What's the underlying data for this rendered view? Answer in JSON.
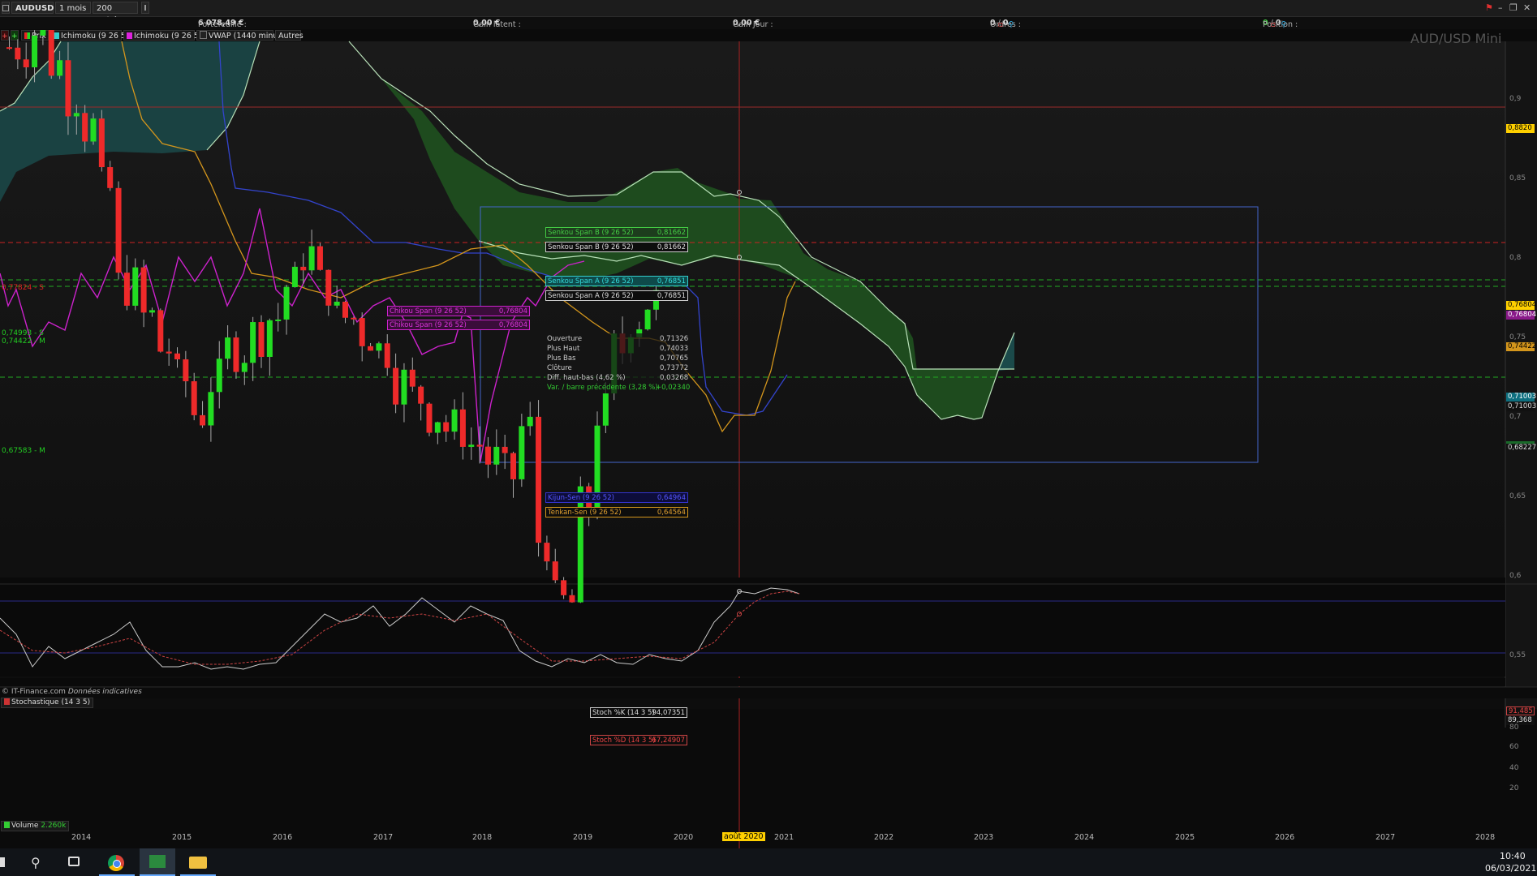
{
  "toolbar": {
    "instrument": "AUDUSD",
    "period": "1 mois",
    "units": "200 unités"
  },
  "infobar": {
    "portfolio_label": "Portefeuille :",
    "portfolio_value": "6 078,49 €",
    "gain_latent_label": "Gain latent :",
    "gain_latent_value": "0,00 €",
    "gain_jour_label": "Gain Jour :",
    "gain_jour_value": "0,00 €",
    "orders_label": "Ordres :",
    "orders_value": "0",
    "orders_value2": "0",
    "position_label": "Position :",
    "position_value": "0",
    "position_value2": "0"
  },
  "indicators": {
    "prix": "Prix",
    "ichimoku1": "Ichimoku (9 26 52)",
    "ichimoku2": "Ichimoku (9 26 52)",
    "vwap": "VWAP (1440 minutes)",
    "autres": "Autres"
  },
  "chart_title": "AUD/USD Mini",
  "copyright": "© IT-Finance.com",
  "copyright_note": "Données indicatives",
  "price_axis": [
    "0,9",
    "0,85",
    "0,8",
    "0,75",
    "0,7",
    "0,65",
    "0,6",
    "0,55"
  ],
  "price_tags": {
    "crosshair": "0,8820",
    "last1": "0,76804",
    "last2": "0,76804",
    "lvl_a": "0,74422",
    "lvl_b": "0,71003",
    "lvl_c": "0,71003",
    "lvl_d": "0,68227"
  },
  "levels": {
    "r1": "0,77824 - S",
    "s1": "0,74993 - S",
    "m1": "0,74422 - M",
    "m2": "0,67583 - M"
  },
  "tooltips": {
    "ssb1_label": "Senkou Span B (9 26 52)",
    "ssb1_value": "0,81662",
    "ssb2_label": "Senkou Span B (9 26 52)",
    "ssb2_value": "0,81662",
    "ssa1_label": "Senkou Span A (9 26 52)",
    "ssa1_value": "0,76851",
    "ssa2_label": "Senkou Span A (9 26 52)",
    "ssa2_value": "0,76851",
    "chikou1_label": "Chikou Span (9 26 52)",
    "chikou1_value": "0,76804",
    "chikou2_label": "Chikou Span (9 26 52)",
    "chikou2_value": "0,76804",
    "kijun_label": "Kijun-Sen (9 26 52)",
    "kijun_value": "0,64964",
    "tenkan_label": "Tenkan-Sen (9 26 52)",
    "tenkan_value": "0,64564"
  },
  "ohlc": [
    {
      "label": "Ouverture",
      "value": "0,71326"
    },
    {
      "label": "Plus Haut",
      "value": "0,74033"
    },
    {
      "label": "Plus Bas",
      "value": "0,70765"
    },
    {
      "label": "Clôture",
      "value": "0,73772"
    },
    {
      "label": "Diff. haut-bas (4,62 %)",
      "value": "0,03268"
    },
    {
      "label": "Var. / barre précédente (3,28 %)",
      "value": "+0,02340"
    }
  ],
  "stoch": {
    "title": "Stochastique (14 3 5)",
    "k_label": "Stoch %K (14 3 5)",
    "k_value": "94,07351",
    "d_label": "Stoch %D (14 3 5)",
    "d_value": "67,24907",
    "tag_k": "91,485",
    "tag_d": "89,368",
    "axis": [
      "80",
      "60",
      "40",
      "20"
    ]
  },
  "volume": {
    "title": "Volume",
    "value": "2.260k"
  },
  "years": [
    "2014",
    "2015",
    "2016",
    "2017",
    "2018",
    "2019",
    "2020",
    "août 2020",
    "2021",
    "2022",
    "2023",
    "2024",
    "2025",
    "2026",
    "2027",
    "2028"
  ],
  "clock": {
    "time": "10:40",
    "date": "06/03/2021"
  },
  "colors": {
    "bull": "#22dd22",
    "bear": "#ee2a2a",
    "cloud": "#1e4d1e",
    "kijun": "#3344cc",
    "tenkan": "#d4961c",
    "chikou": "#cc22cc"
  }
}
